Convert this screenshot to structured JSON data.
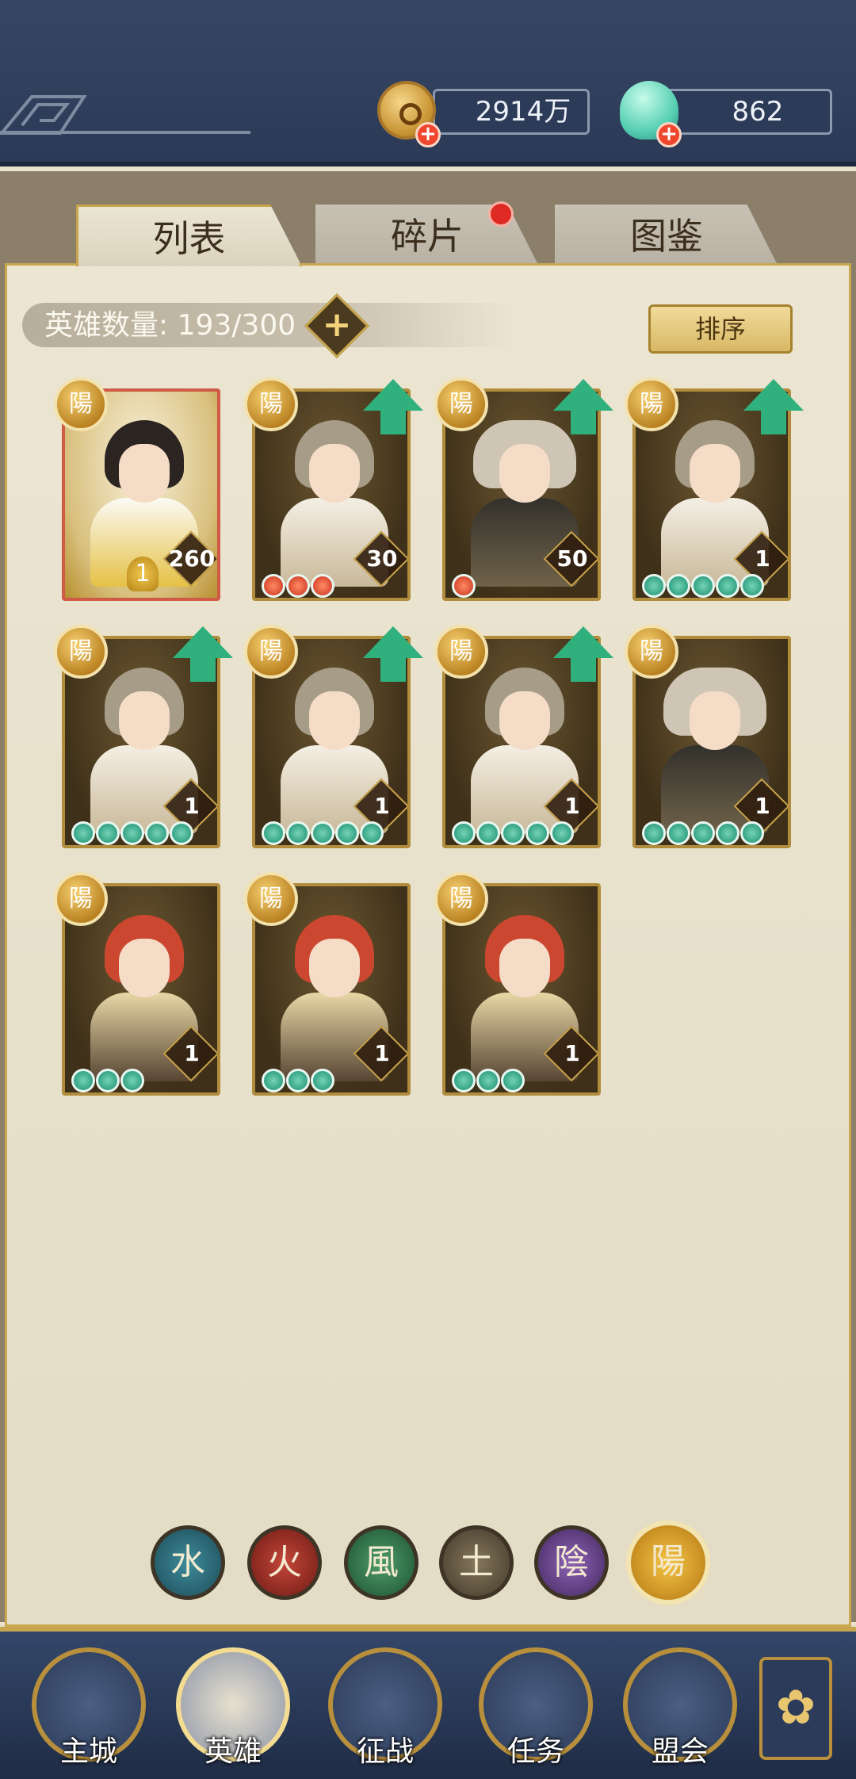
{
  "currency": {
    "coins": "2914万",
    "gems": "862"
  },
  "tabs": [
    {
      "label": "列表"
    },
    {
      "label": "碎片"
    },
    {
      "label": "图鉴"
    }
  ],
  "hero_count": {
    "label": "英雄数量: 193/300",
    "current": 193,
    "max": 300
  },
  "sort_label": "排序",
  "badge_char": "陽",
  "heroes": [
    {
      "portrait": "queen",
      "level": "260",
      "stars": 0,
      "star_color": "none",
      "upgrade": false,
      "rank": "1"
    },
    {
      "portrait": "light-haired-swordsman",
      "level": "30",
      "stars": 3,
      "star_color": "red",
      "upgrade": true
    },
    {
      "portrait": "elder-warrior",
      "level": "50",
      "stars": 1,
      "star_color": "red",
      "upgrade": true
    },
    {
      "portrait": "light-haired-swordsman",
      "level": "1",
      "stars": 5,
      "star_color": "teal",
      "upgrade": true
    },
    {
      "portrait": "light-haired-swordsman",
      "level": "1",
      "stars": 5,
      "star_color": "teal",
      "upgrade": true
    },
    {
      "portrait": "light-haired-swordsman",
      "level": "1",
      "stars": 5,
      "star_color": "teal",
      "upgrade": true
    },
    {
      "portrait": "light-haired-swordsman",
      "level": "1",
      "stars": 5,
      "star_color": "teal",
      "upgrade": true
    },
    {
      "portrait": "elder-warrior",
      "level": "1",
      "stars": 5,
      "star_color": "teal",
      "upgrade": false
    },
    {
      "portrait": "red-haired-girl",
      "level": "1",
      "stars": 3,
      "star_color": "teal",
      "upgrade": false
    },
    {
      "portrait": "red-haired-girl",
      "level": "1",
      "stars": 3,
      "star_color": "teal",
      "upgrade": false
    },
    {
      "portrait": "red-haired-girl",
      "level": "1",
      "stars": 3,
      "star_color": "teal",
      "upgrade": false
    }
  ],
  "element_filters": [
    {
      "char": "水",
      "name": "water",
      "color": "#2d6f7d"
    },
    {
      "char": "火",
      "name": "fire",
      "color": "#a9352a"
    },
    {
      "char": "風",
      "name": "wind",
      "color": "#357a4b"
    },
    {
      "char": "土",
      "name": "earth",
      "color": "#6b5f48"
    },
    {
      "char": "陰",
      "name": "yin",
      "color": "#6c4690"
    },
    {
      "char": "陽",
      "name": "yang",
      "color": "#e0a52c",
      "selected": true
    }
  ],
  "nav": [
    {
      "label": "主城"
    },
    {
      "label": "英雄",
      "selected": true
    },
    {
      "label": "征战"
    },
    {
      "label": "任务"
    },
    {
      "label": "盟会"
    }
  ],
  "nav_more_icon": "flower-menu-icon"
}
